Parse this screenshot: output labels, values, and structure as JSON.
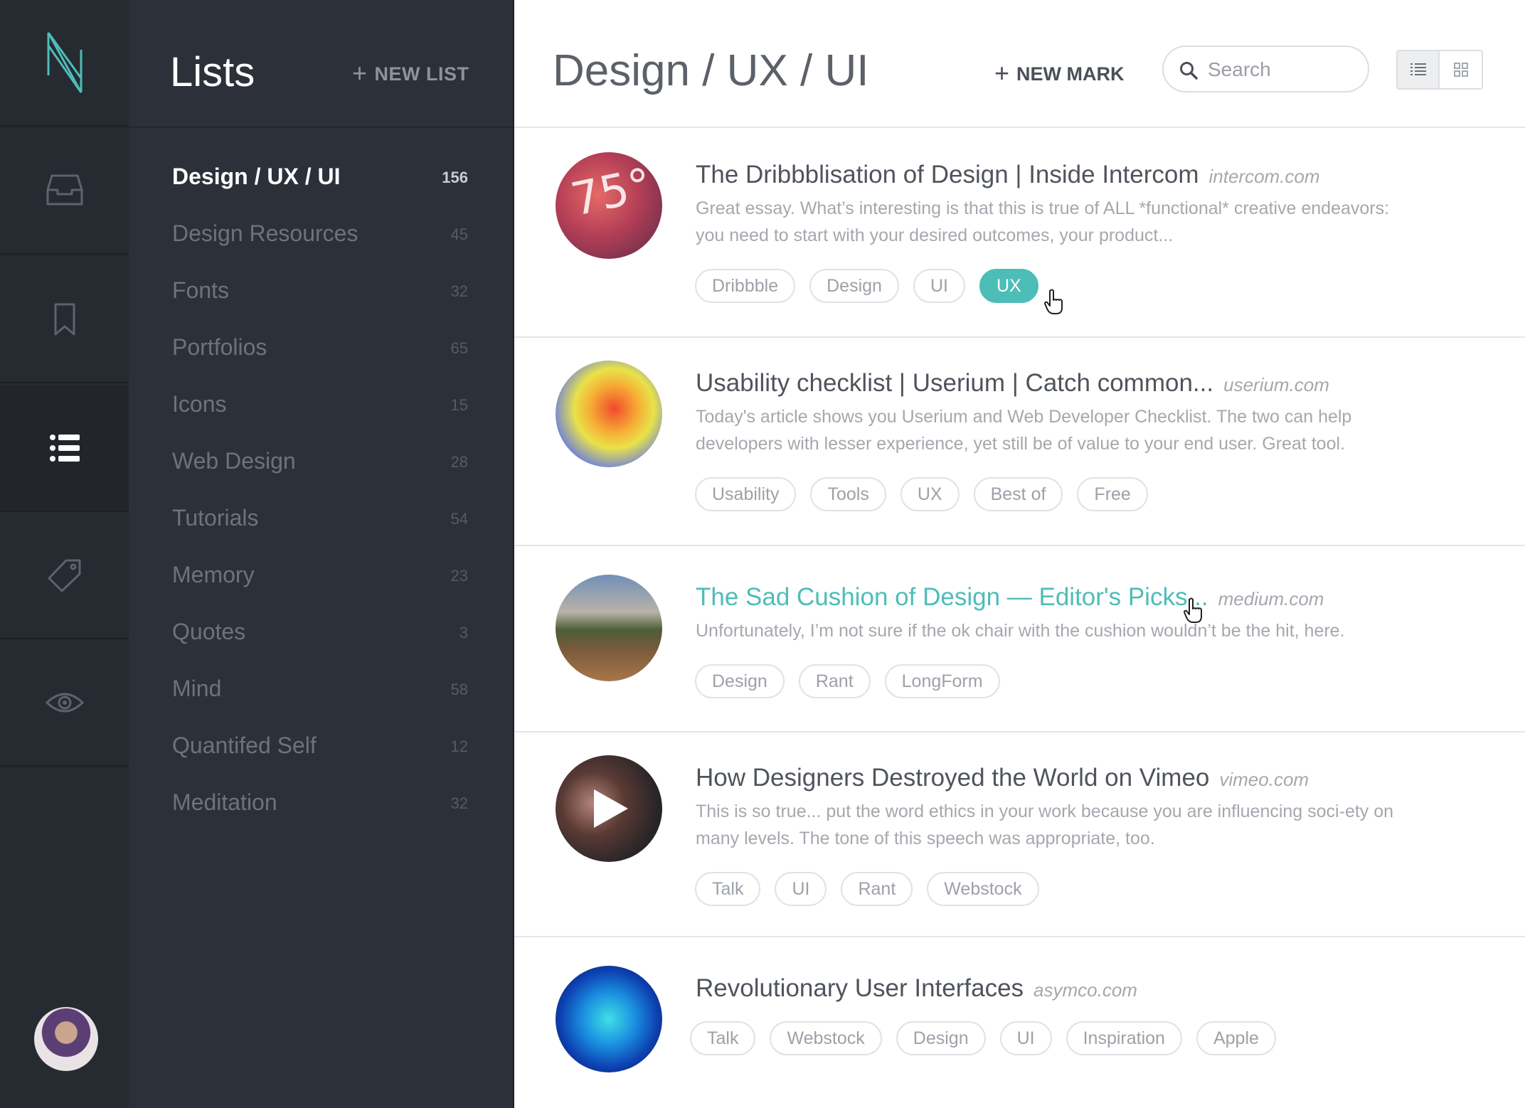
{
  "rail": {
    "items": [
      {
        "icon": "logo-icon"
      },
      {
        "icon": "inbox-icon"
      },
      {
        "icon": "bookmark-icon"
      },
      {
        "icon": "list-icon",
        "active": true
      },
      {
        "icon": "tag-icon"
      },
      {
        "icon": "eye-icon"
      }
    ],
    "avatar": "user-avatar"
  },
  "lists": {
    "title": "Lists",
    "new_list_label": "NEW LIST",
    "items": [
      {
        "name": "Design / UX / UI",
        "count": "156",
        "active": true
      },
      {
        "name": "Design Resources",
        "count": "45"
      },
      {
        "name": "Fonts",
        "count": "32"
      },
      {
        "name": "Portfolios",
        "count": "65"
      },
      {
        "name": "Icons",
        "count": "15"
      },
      {
        "name": "Web Design",
        "count": "28"
      },
      {
        "name": "Tutorials",
        "count": "54"
      },
      {
        "name": "Memory",
        "count": "23"
      },
      {
        "name": "Quotes",
        "count": "3"
      },
      {
        "name": "Mind",
        "count": "58"
      },
      {
        "name": "Quantifed Self",
        "count": "12"
      },
      {
        "name": "Meditation",
        "count": "32"
      }
    ]
  },
  "main": {
    "title": "Design / UX / UI",
    "new_mark_label": "NEW MARK",
    "search_placeholder": "Search",
    "view_modes": [
      "list-view-icon",
      "grid-view-icon"
    ],
    "active_view": "list-view-icon"
  },
  "marks": [
    {
      "title": "The Dribbblisation of Design | Inside Intercom",
      "domain": "intercom.com",
      "description": "Great essay. What’s interesting is that this is true of ALL *functional* creative endeavors: you need to start with your desired outcomes, your product...",
      "tags": [
        "Dribbble",
        "Design",
        "UI",
        "UX"
      ],
      "active_tag": "UX"
    },
    {
      "title": "Usability checklist | Userium | Catch common...",
      "domain": "userium.com",
      "description": "Today's article shows you Userium and Web Developer Checklist. The two can help developers with lesser experience, yet still be of value to your end user. Great tool.",
      "tags": [
        "Usability",
        "Tools",
        "UX",
        "Best of",
        "Free"
      ]
    },
    {
      "title": "The Sad Cushion of Design — Editor's Picks...",
      "domain": "medium.com",
      "description": "Unfortunately, I’m not sure if the ok chair with the cushion wouldn’t be the hit, here.",
      "tags": [
        "Design",
        "Rant",
        "LongForm"
      ],
      "hovered": true
    },
    {
      "title": "How Designers Destroyed the World on Vimeo",
      "domain": "vimeo.com",
      "description": "This is so true... put the word ethics in your work because you are influencing soci-ety on many levels. The tone of this speech was appropriate, too.",
      "tags": [
        "Talk",
        "UI",
        "Rant",
        "Webstock"
      ]
    },
    {
      "title": "Revolutionary User Interfaces",
      "domain": "asymco.com",
      "description": "",
      "tags": [
        "Talk",
        "Webstock",
        "Design",
        "UI",
        "Inspiration",
        "Apple"
      ]
    }
  ],
  "colors": {
    "accent": "#4dbdb8",
    "rail_bg": "#262a31",
    "sidebar_bg": "#2c3039"
  }
}
